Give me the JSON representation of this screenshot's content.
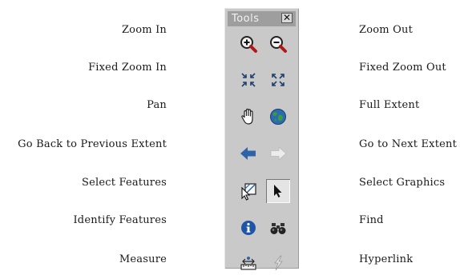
{
  "toolbar": {
    "title": "Tools",
    "close_glyph": "✕"
  },
  "tools": [
    {
      "id": "zoom-in",
      "label": "Zoom In",
      "side": "left",
      "icon": "zoom-in-icon"
    },
    {
      "id": "zoom-out",
      "label": "Zoom Out",
      "side": "right",
      "icon": "zoom-out-icon"
    },
    {
      "id": "fixed-zoom-in",
      "label": "Fixed Zoom In",
      "side": "left",
      "icon": "fixed-zoom-in-icon"
    },
    {
      "id": "fixed-zoom-out",
      "label": "Fixed Zoom Out",
      "side": "right",
      "icon": "fixed-zoom-out-icon"
    },
    {
      "id": "pan",
      "label": "Pan",
      "side": "left",
      "icon": "hand-icon"
    },
    {
      "id": "full-extent",
      "label": "Full Extent",
      "side": "right",
      "icon": "globe-icon"
    },
    {
      "id": "previous-extent",
      "label": "Go Back to Previous Extent",
      "side": "left",
      "icon": "back-arrow-icon"
    },
    {
      "id": "next-extent",
      "label": "Go to Next Extent",
      "side": "right",
      "icon": "forward-arrow-icon"
    },
    {
      "id": "select-features",
      "label": "Select Features",
      "side": "left",
      "icon": "select-features-icon"
    },
    {
      "id": "select-graphics",
      "label": "Select Graphics",
      "side": "right",
      "icon": "arrow-pointer-icon",
      "pressed": true
    },
    {
      "id": "identify",
      "label": "Identify Features",
      "side": "left",
      "icon": "info-icon"
    },
    {
      "id": "find",
      "label": "Find",
      "side": "right",
      "icon": "binoculars-icon"
    },
    {
      "id": "measure",
      "label": "Measure",
      "side": "left",
      "icon": "measure-icon"
    },
    {
      "id": "hyperlink",
      "label": "Hyperlink",
      "side": "right",
      "icon": "lightning-icon"
    }
  ],
  "colors": {
    "toolbar_bg": "#c9c9c9",
    "titlebar_bg": "#9e9e9e",
    "arrow_blue": "#2f63a8",
    "info_blue": "#1d55a8"
  }
}
